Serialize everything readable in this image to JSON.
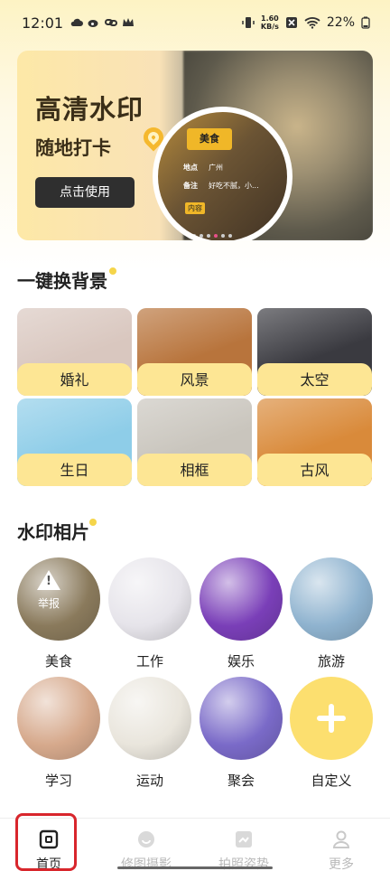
{
  "status_bar": {
    "time": "12:01",
    "net_speed_value": "1.60",
    "net_speed_unit": "KB/s",
    "battery": "22%"
  },
  "banner": {
    "title": "高清水印",
    "subtitle": "随地打卡",
    "button_label": "点击使用",
    "watermark_header": "美食",
    "wm_row1_key": "地点",
    "wm_row1_val": "广州",
    "wm_row2_key": "备注",
    "wm_row2_val": "好吃不腻，小...",
    "wm_tag": "内容"
  },
  "backgrounds": {
    "title": "一键换背景",
    "items": [
      {
        "label": "婚礼",
        "color": "#d9c7bf"
      },
      {
        "label": "风景",
        "color": "#b8743c"
      },
      {
        "label": "太空",
        "color": "#3a3a40"
      },
      {
        "label": "生日",
        "color": "#8ecde8"
      },
      {
        "label": "相框",
        "color": "#c9c5bd"
      },
      {
        "label": "古风",
        "color": "#d98a3a"
      }
    ]
  },
  "watermark_photos": {
    "title": "水印相片",
    "report_label": "举报",
    "items": [
      {
        "label": "美食",
        "color": "#8a7a5c"
      },
      {
        "label": "工作",
        "color": "#e6e4ea"
      },
      {
        "label": "娱乐",
        "color": "#7a3fb8"
      },
      {
        "label": "旅游",
        "color": "#8fb3cf"
      },
      {
        "label": "学习",
        "color": "#d6a98c"
      },
      {
        "label": "运动",
        "color": "#e9e5dc"
      },
      {
        "label": "聚会",
        "color": "#7a6ac8"
      },
      {
        "label": "自定义",
        "color": "#fcdf6f"
      }
    ]
  },
  "tabbar": {
    "tabs": [
      {
        "label": "首页",
        "icon": "home-icon"
      },
      {
        "label": "修图摄影",
        "icon": "retouch-icon"
      },
      {
        "label": "拍照姿势",
        "icon": "pose-icon"
      },
      {
        "label": "更多",
        "icon": "profile-icon"
      }
    ]
  }
}
